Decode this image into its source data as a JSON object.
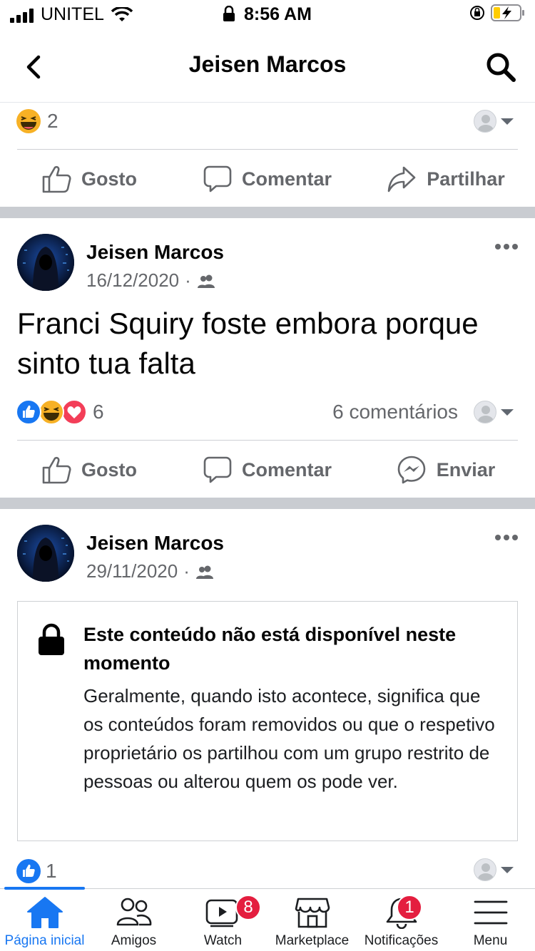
{
  "status_bar": {
    "carrier": "UNITEL",
    "time": "8:56 AM"
  },
  "header": {
    "title": "Jeisen Marcos"
  },
  "prev_post": {
    "reaction_count": "2",
    "actions": {
      "like": "Gosto",
      "comment": "Comentar",
      "share": "Partilhar"
    }
  },
  "post1": {
    "author": "Jeisen Marcos",
    "date": "16/12/2020",
    "dot": "·",
    "text": "Franci Squiry foste embora porque sinto tua falta",
    "reaction_count": "6",
    "comments": "6 comentários",
    "actions": {
      "like": "Gosto",
      "comment": "Comentar",
      "send": "Enviar"
    }
  },
  "post2": {
    "author": "Jeisen Marcos",
    "date": "29/11/2020",
    "dot": "·",
    "unavailable": {
      "title": "Este conteúdo não está disponível neste momento",
      "body": "Geralmente, quando isto acontece, significa que os conteúdos foram removidos ou que o respetivo proprietário os partilhou com um grupo restrito de pessoas ou alterou quem os pode ver."
    },
    "reaction_count": "1"
  },
  "tabbar": {
    "home": "Página inicial",
    "friends": "Amigos",
    "watch": "Watch",
    "watch_badge": "8",
    "marketplace": "Marketplace",
    "notifications": "Notificações",
    "notifications_badge": "1",
    "menu": "Menu"
  },
  "colors": {
    "accent": "#1877f2",
    "badge": "#e41e3f",
    "separator": "#c9ccd1"
  }
}
